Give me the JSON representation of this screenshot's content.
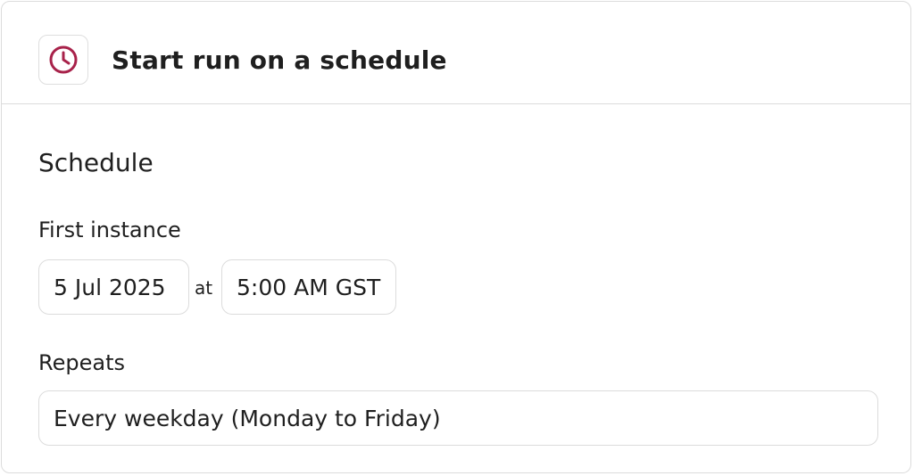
{
  "header": {
    "title": "Start run on a schedule",
    "icon": "clock-icon",
    "icon_color": "#a8224a"
  },
  "schedule": {
    "section_title": "Schedule",
    "first_instance_label": "First instance",
    "date_value": "5 Jul 2025",
    "at_label": "at",
    "time_value": "5:00 AM GST",
    "repeats_label": "Repeats",
    "repeats_value": "Every weekday (Monday to Friday)"
  }
}
